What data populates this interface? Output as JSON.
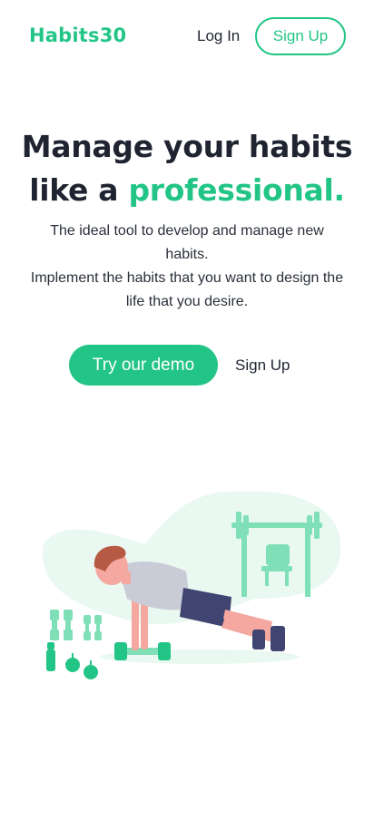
{
  "header": {
    "logo": "Habits30",
    "login_label": "Log In",
    "signup_label": "Sign Up"
  },
  "hero": {
    "headline_line1": "Manage your habits",
    "headline_line2_prefix": "like a ",
    "headline_line2_accent": "professional.",
    "subtitle_line1": "The ideal tool to develop and manage new habits.",
    "subtitle_line2": "Implement the habits that you want to design the life that you desire.",
    "demo_button_label": "Try our demo",
    "signup_link_label": "Sign Up"
  },
  "illustration": {
    "icon": "workout-illustration",
    "colors": {
      "accent": "#22c585",
      "accent_soft": "#7fe0b7",
      "background_blob": "#e9f8f1",
      "shirt": "#c9cbd6",
      "shorts": "#3f4470",
      "skin": "#f4a8a0",
      "hair": "#b65a44"
    }
  },
  "colors": {
    "brand": "#22c585",
    "text": "#1f2430",
    "background": "#ffffff"
  }
}
